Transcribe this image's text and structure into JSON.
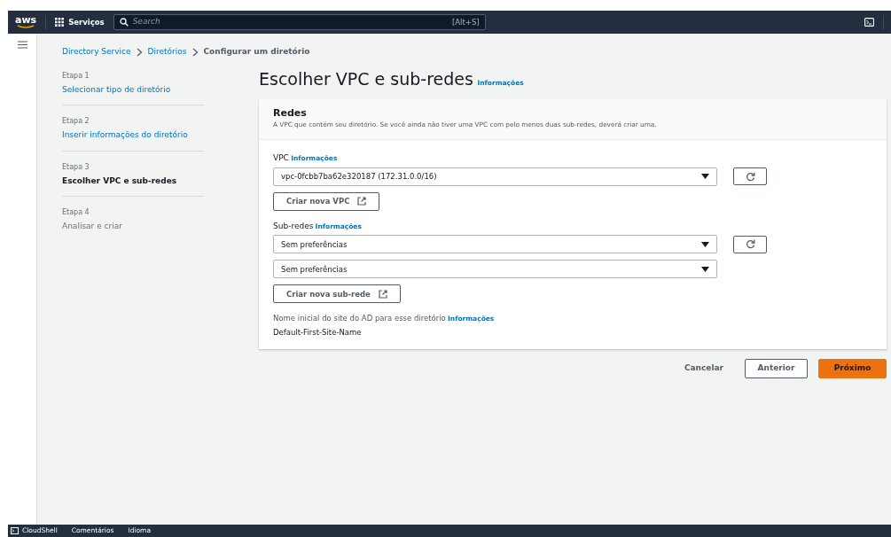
{
  "top_nav": {
    "logo": "aws",
    "services": "Serviços",
    "search": {
      "placeholder": "Search",
      "shortcut": "[Alt+S]"
    }
  },
  "breadcrumbs": [
    {
      "label": "Directory Service",
      "link": true
    },
    {
      "label": "Diretórios",
      "link": true
    },
    {
      "label": "Configurar um diretório",
      "link": false
    }
  ],
  "steps": [
    {
      "step": "Etapa 1",
      "label": "Selecionar tipo de diretório",
      "selected": false,
      "disabled": false
    },
    {
      "step": "Etapa 2",
      "label": "Inserir informações do diretório",
      "selected": false,
      "disabled": false
    },
    {
      "step": "Etapa 3",
      "label": "Escolher VPC e sub-redes",
      "selected": true,
      "disabled": false
    },
    {
      "step": "Etapa 4",
      "label": "Analisar e criar",
      "selected": false,
      "disabled": true
    }
  ],
  "page": {
    "title": "Escolher VPC e sub-redes",
    "info": "Informações"
  },
  "panel": {
    "title": "Redes",
    "description": "A VPC que contém seu diretório. Se você ainda não tiver uma VPC com pelo menos duas sub-redes, deverá criar uma.",
    "vpc": {
      "label": "VPC",
      "info": "Informações",
      "value": "vpc-0fcbb7ba62e320187 (172.31.0.0/16)",
      "create_button": "Criar nova VPC"
    },
    "subnets": {
      "label": "Sub-redes",
      "info": "Informações",
      "values": [
        "Sem preferências",
        "Sem preferências"
      ],
      "create_button": "Criar nova sub-rede"
    },
    "site": {
      "label": "Nome inicial do site do AD para esse diretório",
      "info": "Informações",
      "value": "Default-First-Site-Name"
    }
  },
  "actions": {
    "cancel": "Cancelar",
    "previous": "Anterior",
    "next": "Próximo"
  },
  "footer": [
    "CloudShell",
    "Comentários",
    "Idioma"
  ]
}
